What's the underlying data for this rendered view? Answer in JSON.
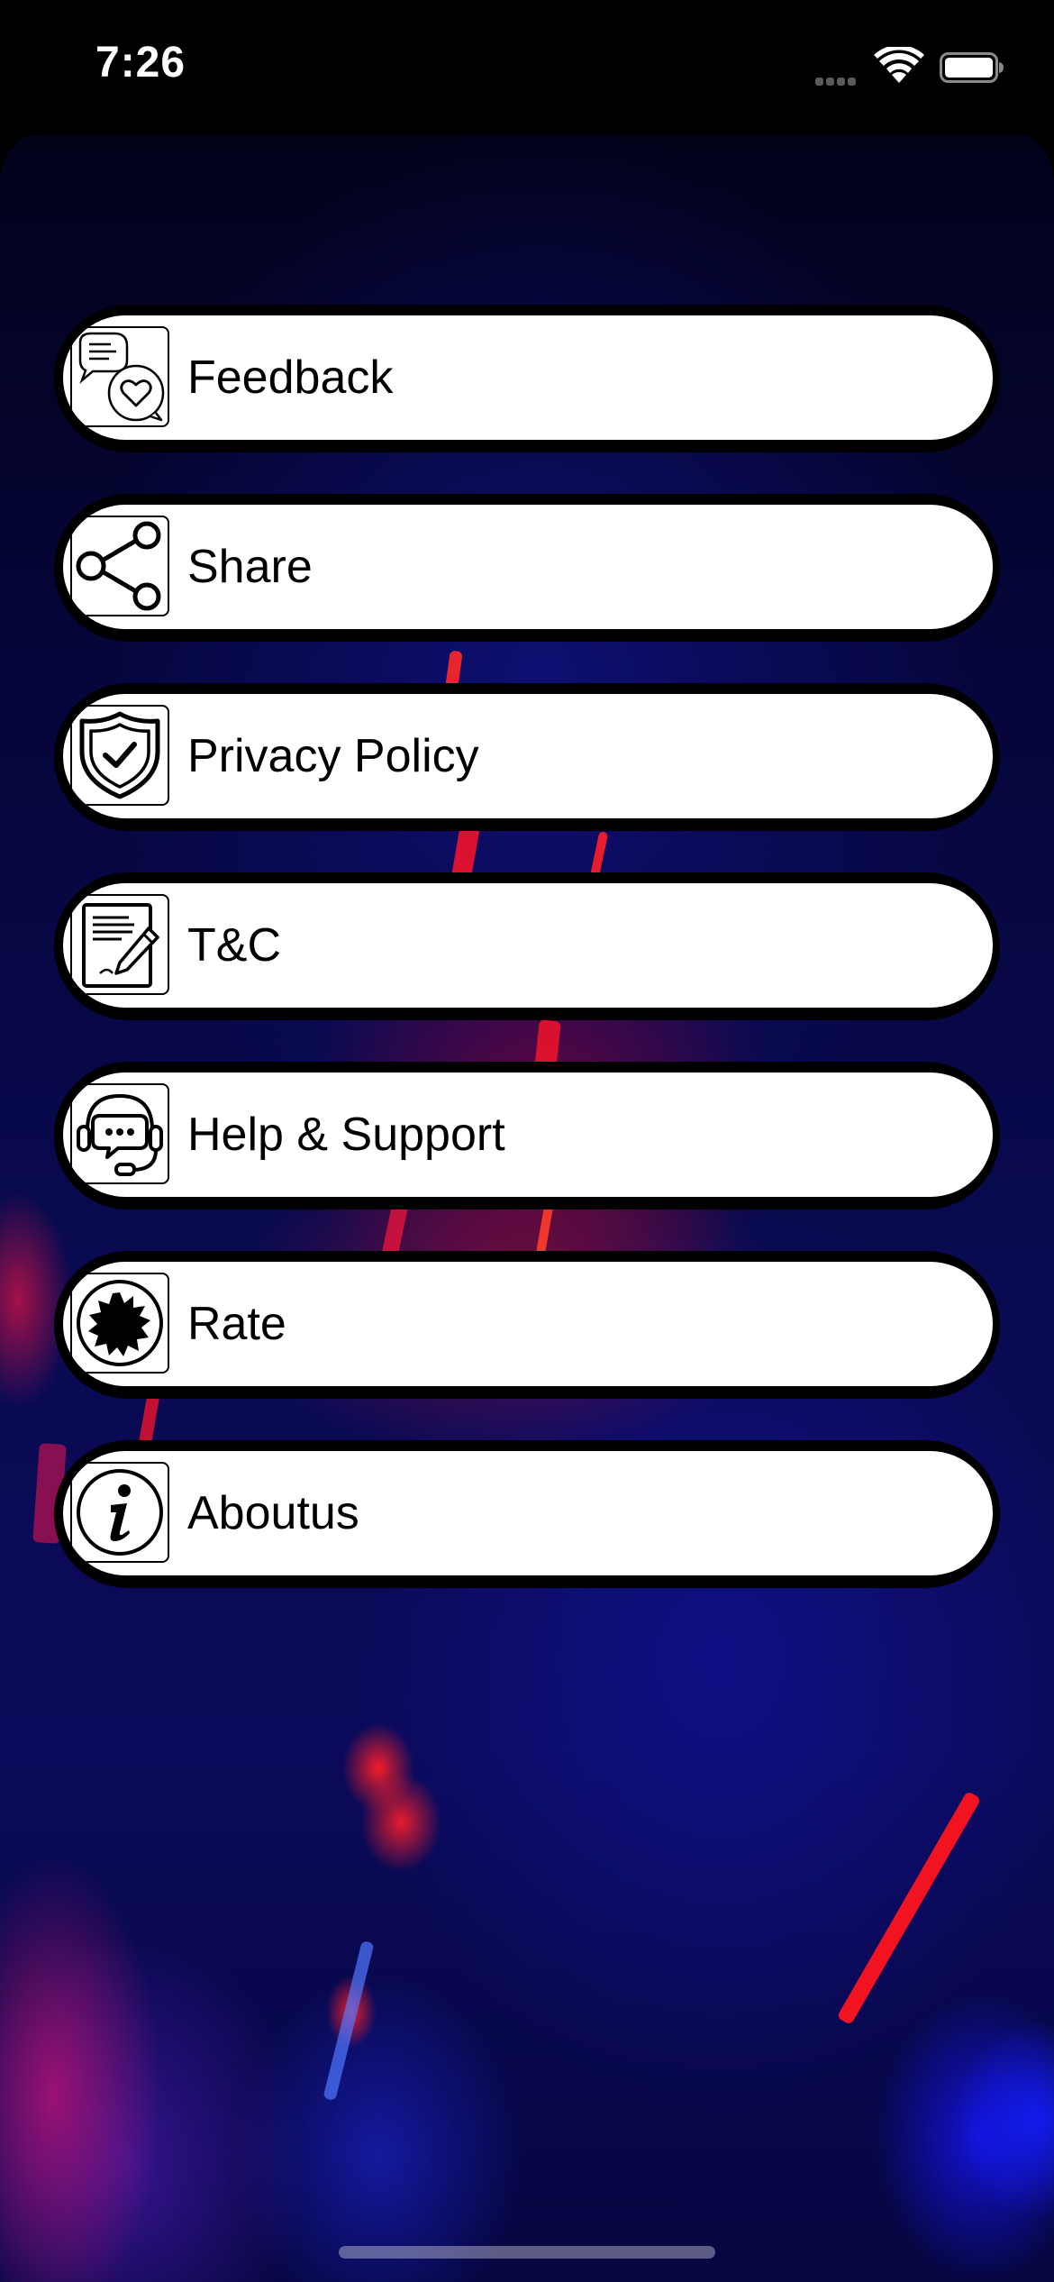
{
  "status_bar": {
    "time": "7:26"
  },
  "menu": {
    "items": [
      {
        "label": "Feedback",
        "icon": "feedback-icon"
      },
      {
        "label": "Share",
        "icon": "share-icon"
      },
      {
        "label": "Privacy Policy",
        "icon": "shield-check-icon"
      },
      {
        "label": "T&C",
        "icon": "document-pen-icon"
      },
      {
        "label": "Help & Support",
        "icon": "headset-chat-icon"
      },
      {
        "label": "Rate",
        "icon": "badge-icon"
      },
      {
        "label": "Aboutus",
        "icon": "info-icon"
      }
    ]
  },
  "colors": {
    "background_top": "#02021a",
    "background_bottom": "#0b0a5a",
    "button_fill": "#ffffff",
    "button_border": "#000000",
    "accent_red": "#ff1e28",
    "accent_blue": "#1414e6"
  }
}
